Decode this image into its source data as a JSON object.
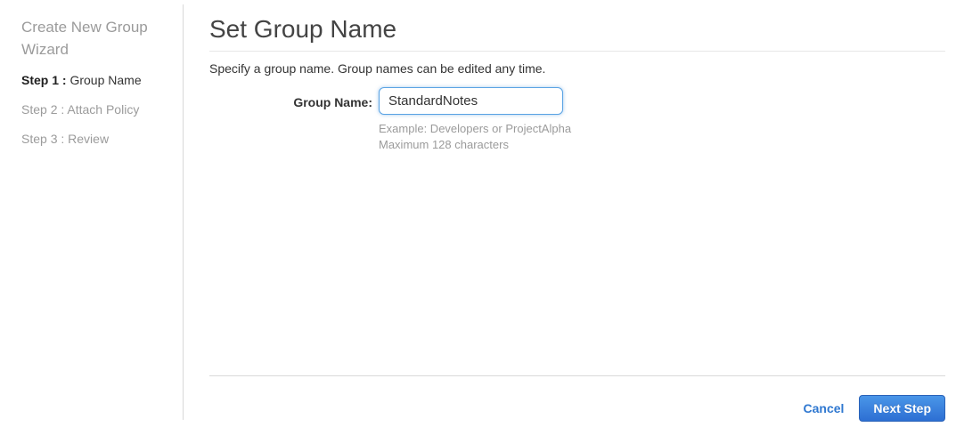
{
  "sidebar": {
    "title": "Create New Group Wizard",
    "steps": [
      {
        "prefix": "Step 1 :",
        "label": "Group Name",
        "active": true
      },
      {
        "prefix": "Step 2 :",
        "label": "Attach Policy",
        "active": false
      },
      {
        "prefix": "Step 3 :",
        "label": "Review",
        "active": false
      }
    ]
  },
  "main": {
    "title": "Set Group Name",
    "description": "Specify a group name. Group names can be edited any time.",
    "form": {
      "group_name_label": "Group Name:",
      "group_name_value": "StandardNotes",
      "hint_line1": "Example: Developers or ProjectAlpha",
      "hint_line2": "Maximum 128 characters"
    },
    "footer": {
      "cancel_label": "Cancel",
      "next_label": "Next Step"
    }
  },
  "colors": {
    "accent_blue": "#2e77d0",
    "button_gradient_top": "#4a96e8",
    "button_gradient_bottom": "#2d6fd3",
    "input_focus_border": "#59a3e4",
    "muted_text": "#9b9b9b",
    "title_text": "#444444"
  }
}
